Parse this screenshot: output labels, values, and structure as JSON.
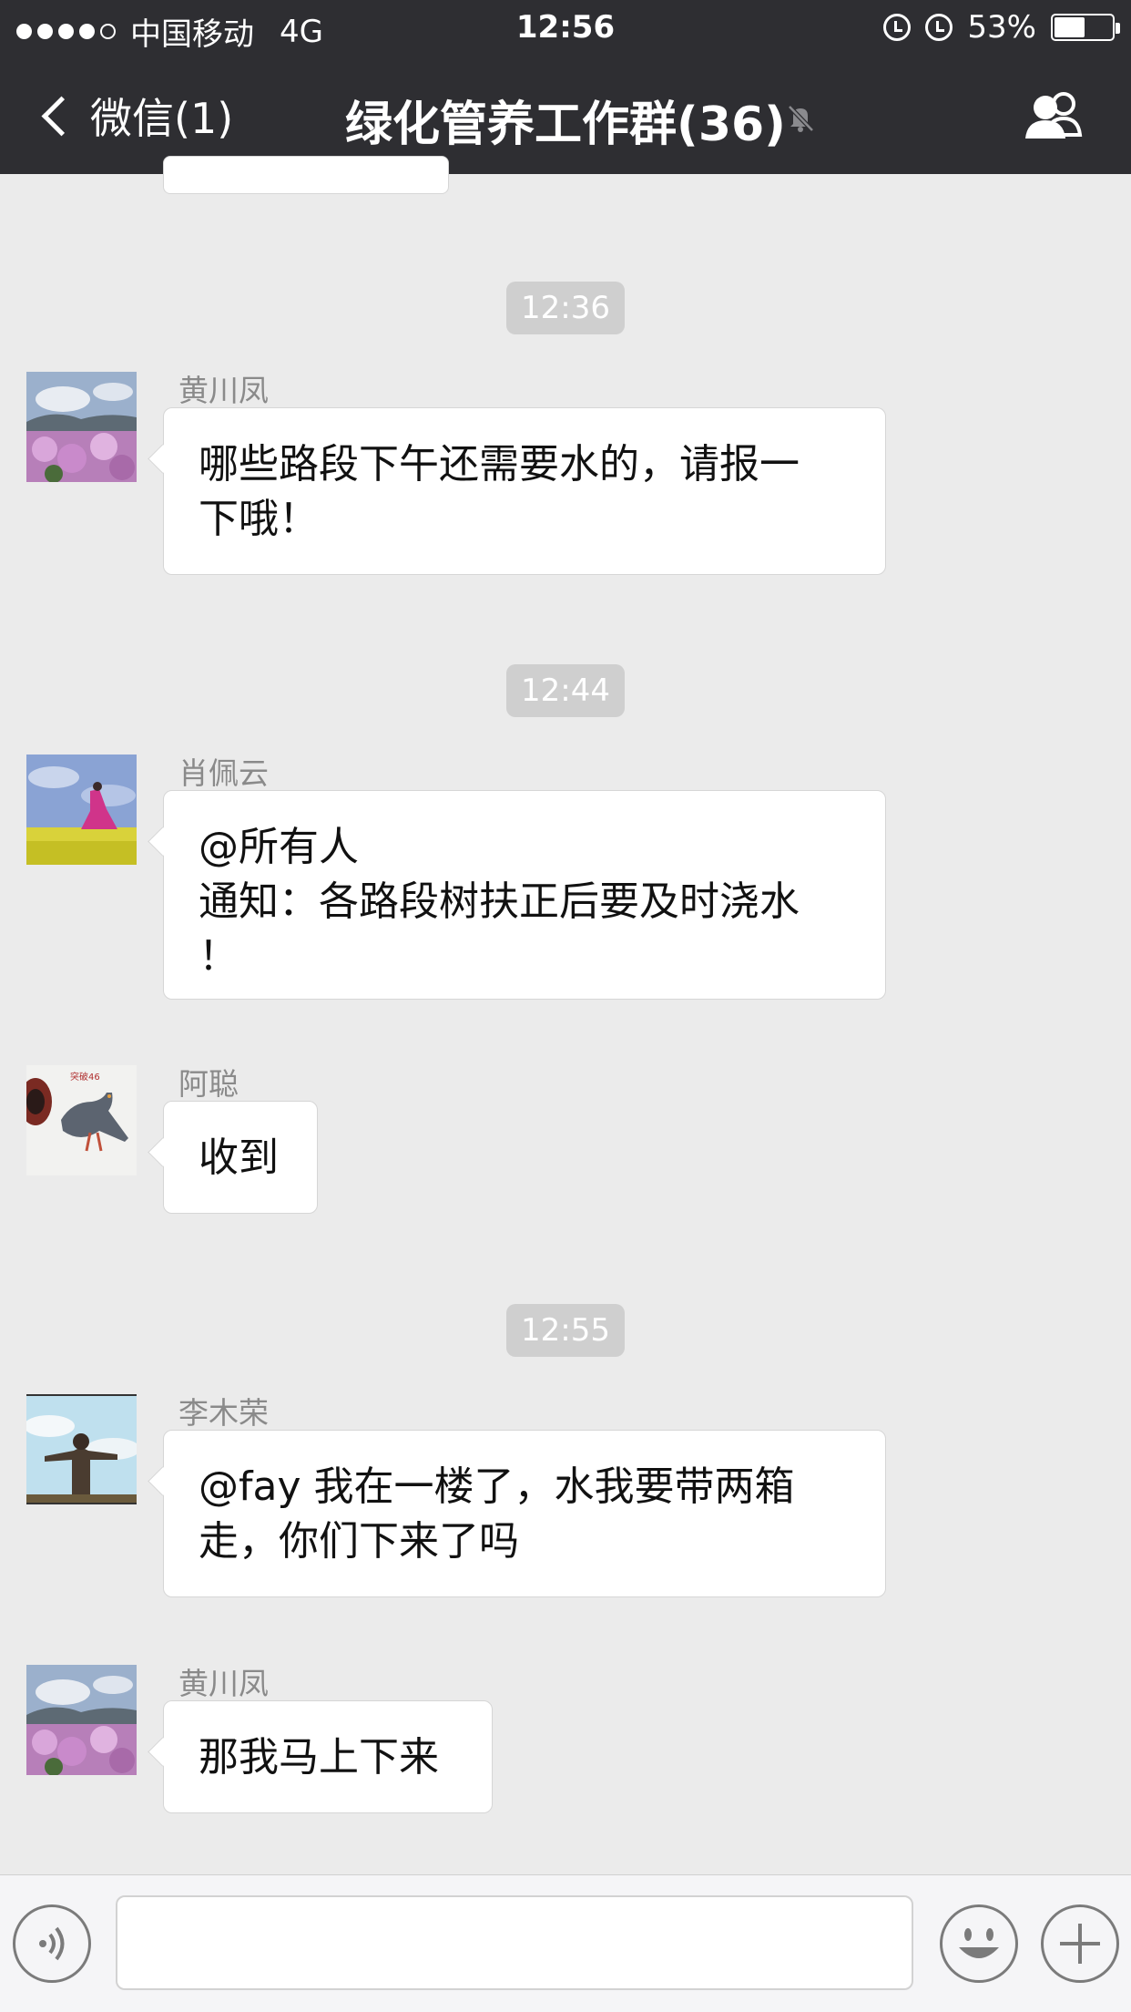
{
  "status_bar": {
    "carrier": "中国移动",
    "network": "4G",
    "time": "12:56",
    "battery_percent": "53%",
    "battery_level": 0.53
  },
  "nav": {
    "back_label": "微信(1)",
    "title": "绿化管养工作群(36)"
  },
  "timestamps": [
    "12:36",
    "12:44",
    "12:55"
  ],
  "messages": [
    {
      "sender": "黄川凤",
      "text": "哪些路段下午还需要水的，请报一\n下哦！"
    },
    {
      "sender": "肖佩云",
      "text": "@所有人\n通知：各路段树扶正后要及时浇水\n！"
    },
    {
      "sender": "阿聪",
      "text": "收到"
    },
    {
      "sender": "李木荣",
      "text": "@fay 我在一楼了，水我要带两箱\n走，你们下来了吗"
    },
    {
      "sender": "黄川凤",
      "text": "那我马上下来"
    }
  ],
  "icons": {
    "mute": "bell-slash-icon",
    "members": "group-members-icon",
    "voice": "voice-input-icon",
    "emoji": "emoji-icon",
    "more": "plus-icon"
  },
  "colors": {
    "nav_background": "#2e2e32",
    "chat_background": "#ebebeb",
    "bubble_background": "#ffffff",
    "timestamp_background": "#cfcfcf"
  }
}
